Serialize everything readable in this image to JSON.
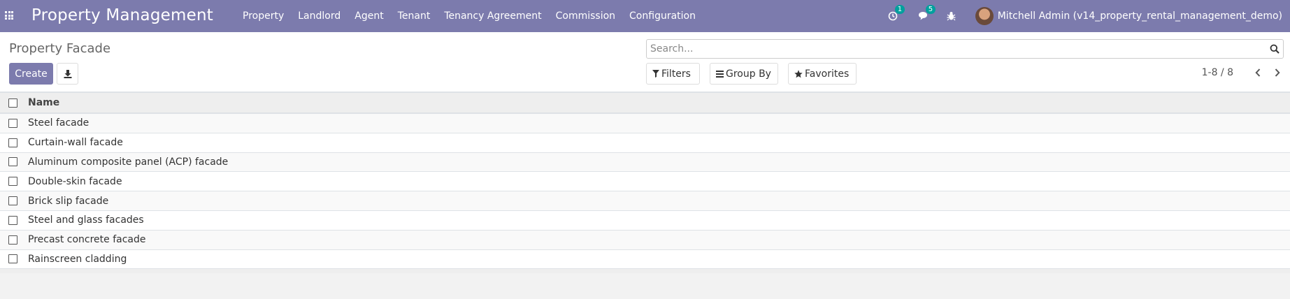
{
  "navbar": {
    "brand": "Property Management",
    "menu": [
      "Property",
      "Landlord",
      "Agent",
      "Tenant",
      "Tenancy Agreement",
      "Commission",
      "Configuration"
    ],
    "activity_count": "1",
    "messages_count": "5",
    "user_name": "Mitchell Admin (v14_property_rental_management_demo)"
  },
  "control_panel": {
    "breadcrumb": "Property Facade",
    "create_label": "Create",
    "search_placeholder": "Search...",
    "filters_label": "Filters",
    "group_by_label": "Group By",
    "favorites_label": "Favorites",
    "pager_value": "1-8 / 8"
  },
  "table": {
    "column_name": "Name",
    "rows": [
      "Steel facade",
      "Curtain-wall facade",
      "Aluminum composite panel (ACP) facade",
      "Double-skin facade",
      "Brick slip facade",
      "Steel and glass facades",
      "Precast concrete facade",
      "Rainscreen cladding"
    ]
  }
}
